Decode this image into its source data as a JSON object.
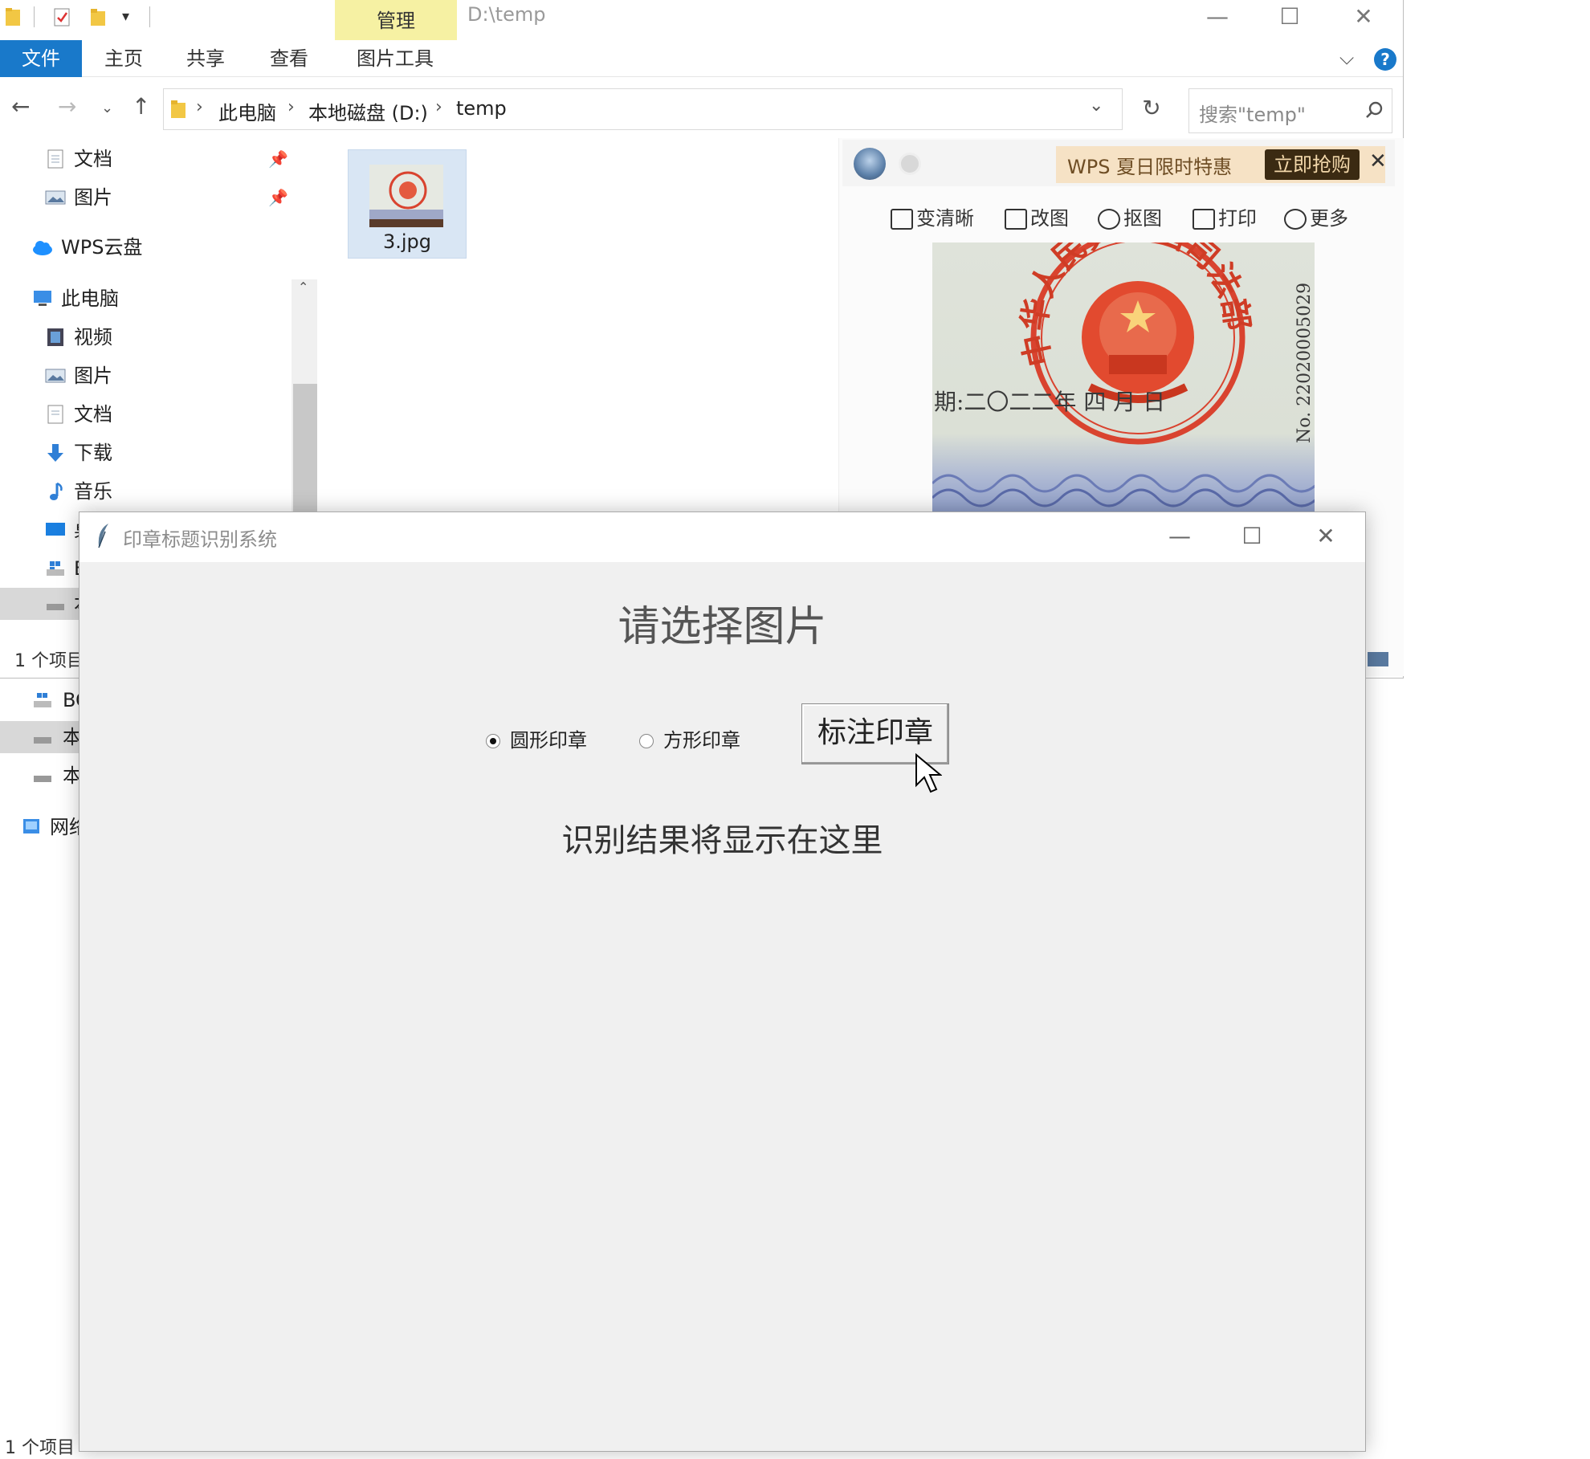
{
  "explorer": {
    "title_path": "D:\\temp",
    "manage_tab": "管理",
    "ribbon_tabs": [
      "文件",
      "主页",
      "共享",
      "查看",
      "图片工具"
    ],
    "breadcrumb": [
      "此电脑",
      "本地磁盘 (D:)",
      "temp"
    ],
    "search_placeholder": "搜索\"temp\"",
    "nav_items": {
      "quick_docs": "文档",
      "quick_pics": "图片",
      "wps_cloud": "WPS云盘",
      "this_pc": "此电脑",
      "videos": "视频",
      "pictures": "图片",
      "documents": "文档",
      "downloads": "下载",
      "music": "音乐",
      "desktop_partial": "桌",
      "drive1_partial": "E",
      "drive2_partial": "本",
      "bootcamp_partial": "BC",
      "drive3_partial": "本",
      "drive4_partial": "本",
      "network_partial": "网络"
    },
    "file": {
      "name": "3.jpg"
    },
    "status_count": "1 个项目",
    "status_count_bottom": "1 个项目"
  },
  "preview": {
    "promo_text": "WPS 夏日限时特惠",
    "promo_button": "立即抢购",
    "tools": [
      "变清晰",
      "改图",
      "抠图",
      "打印",
      "更多"
    ],
    "stamp": {
      "ring_text": "中华人民共和国司法部",
      "date_text": "期:二〇二二年 四 月 日",
      "serial": "No. 22020005029"
    }
  },
  "dialog": {
    "title": "印章标题识别系统",
    "heading": "请选择图片",
    "radio_round": "圆形印章",
    "radio_square": "方形印章",
    "selected": "round",
    "mark_button": "标注印章",
    "result_placeholder": "识别结果将显示在这里"
  },
  "colors": {
    "accent": "#1979ca",
    "manage_tab": "#f6f1a3",
    "promo_bg": "#f6e2c5",
    "stamp_red": "#d9432f"
  }
}
